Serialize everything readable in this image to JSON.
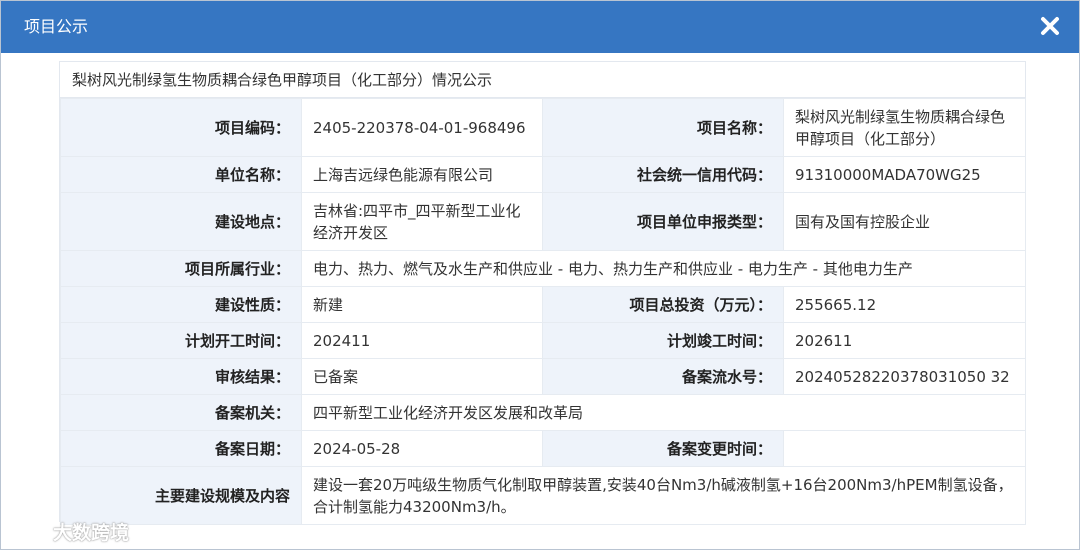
{
  "dialog": {
    "title": "项目公示",
    "caption": "梨树风光制绿氢生物质耦合绿色甲醇项目（化工部分）情况公示"
  },
  "rows": {
    "r1": {
      "l1": "项目编码：",
      "v1": "2405-220378-04-01-968496",
      "l2": "项目名称：",
      "v2": "梨树风光制绿氢生物质耦合绿色甲醇项目（化工部分）"
    },
    "r2": {
      "l1": "单位名称：",
      "v1": "上海吉远绿色能源有限公司",
      "l2": "社会统一信用代码：",
      "v2": "91310000MADA70WG25"
    },
    "r3": {
      "l1": "建设地点：",
      "v1": "吉林省:四平市_四平新型工业化经济开发区",
      "l2": "项目单位申报类型：",
      "v2": "国有及国有控股企业"
    },
    "r4": {
      "l1": "项目所属行业：",
      "v1": "电力、热力、燃气及水生产和供应业 - 电力、热力生产和供应业 - 电力生产 - 其他电力生产"
    },
    "r5": {
      "l1": "建设性质：",
      "v1": "新建",
      "l2": "项目总投资（万元）：",
      "v2": "255665.12"
    },
    "r6": {
      "l1": "计划开工时间：",
      "v1": "202411",
      "l2": "计划竣工时间：",
      "v2": "202611"
    },
    "r7": {
      "l1": "审核结果：",
      "v1": "已备案",
      "l2": "备案流水号：",
      "v2": "20240528220378031050 32"
    },
    "r8": {
      "l1": "备案机关：",
      "v1": "四平新型工业化经济开发区发展和改革局"
    },
    "r9": {
      "l1": "备案日期：",
      "v1": "2024-05-28",
      "l2": "备案变更时间：",
      "v2": ""
    },
    "r10": {
      "l1": "主要建设规模及内容",
      "v1": "建设一套20万吨级生物质气化制取甲醇装置,安装40台Nm3/h碱液制氢+16台200Nm3/hPEM制氢设备，合计制氢能力43200Nm3/h。"
    }
  },
  "watermark": {
    "text": "大数跨境"
  },
  "colors": {
    "titlebar": "#3676c2",
    "label_bg": "#eef3fa",
    "border": "#e6ebf1"
  }
}
